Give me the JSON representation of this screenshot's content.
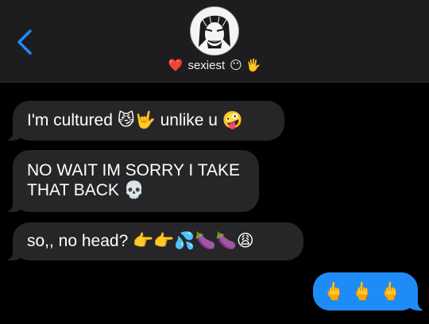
{
  "header": {
    "contact_name": "sexiest",
    "name_prefix_emoji": "❤️",
    "name_suffix_emojis": "😶 🖐"
  },
  "messages": [
    {
      "direction": "incoming",
      "text": "I'm cultured 😼🤟 unlike u 🤪"
    },
    {
      "direction": "incoming",
      "text": "NO WAIT IM SORRY I TAKE\nTHAT BACK 💀"
    },
    {
      "direction": "incoming",
      "text": "so,, no head? 👉👉💦🍆🍆😩"
    },
    {
      "direction": "outgoing",
      "text": "🖕🖕🖕"
    }
  ],
  "colors": {
    "header_bg": "#1d1d1f",
    "incoming_bubble": "#262628",
    "outgoing_bubble": "#1f8bf7",
    "accent": "#1f8bf7"
  }
}
